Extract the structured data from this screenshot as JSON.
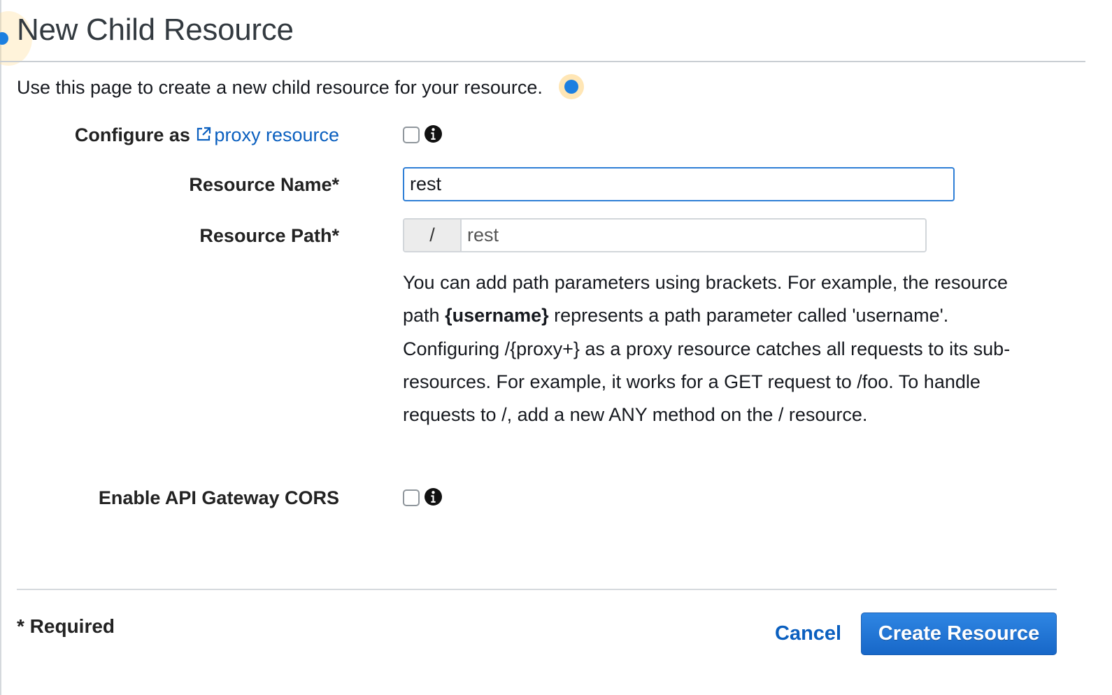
{
  "page": {
    "title": "New Child Resource",
    "intro": "Use this page to create a new child resource for your resource."
  },
  "fields": {
    "proxy": {
      "label_prefix": "Configure as ",
      "link_text": "proxy resource",
      "link_icon": "external-link-icon",
      "checked": false,
      "info_icon": "info-icon"
    },
    "resource_name": {
      "label": "Resource Name*",
      "value": "rest"
    },
    "resource_path": {
      "label": "Resource Path*",
      "prefix": "/",
      "value": "rest"
    },
    "help": {
      "part1": "You can add path parameters using brackets. For example, the resource path ",
      "param_example": "{username}",
      "part2": " represents a path parameter called 'username'. Configuring /{proxy+} as a proxy resource catches all requests to its sub-resources. For example, it works for a GET request to /foo. To handle requests to /, add a new ANY method on the / resource."
    },
    "cors": {
      "label": "Enable API Gateway CORS",
      "checked": false,
      "info_icon": "info-icon"
    }
  },
  "footer": {
    "required_note": "* Required",
    "cancel_label": "Cancel",
    "create_label": "Create Resource"
  },
  "colors": {
    "link": "#0a5fbf",
    "primary_button": "#1f74d4",
    "focus_border": "#2f7fd6",
    "hint_dot": "#1c7fe0"
  }
}
